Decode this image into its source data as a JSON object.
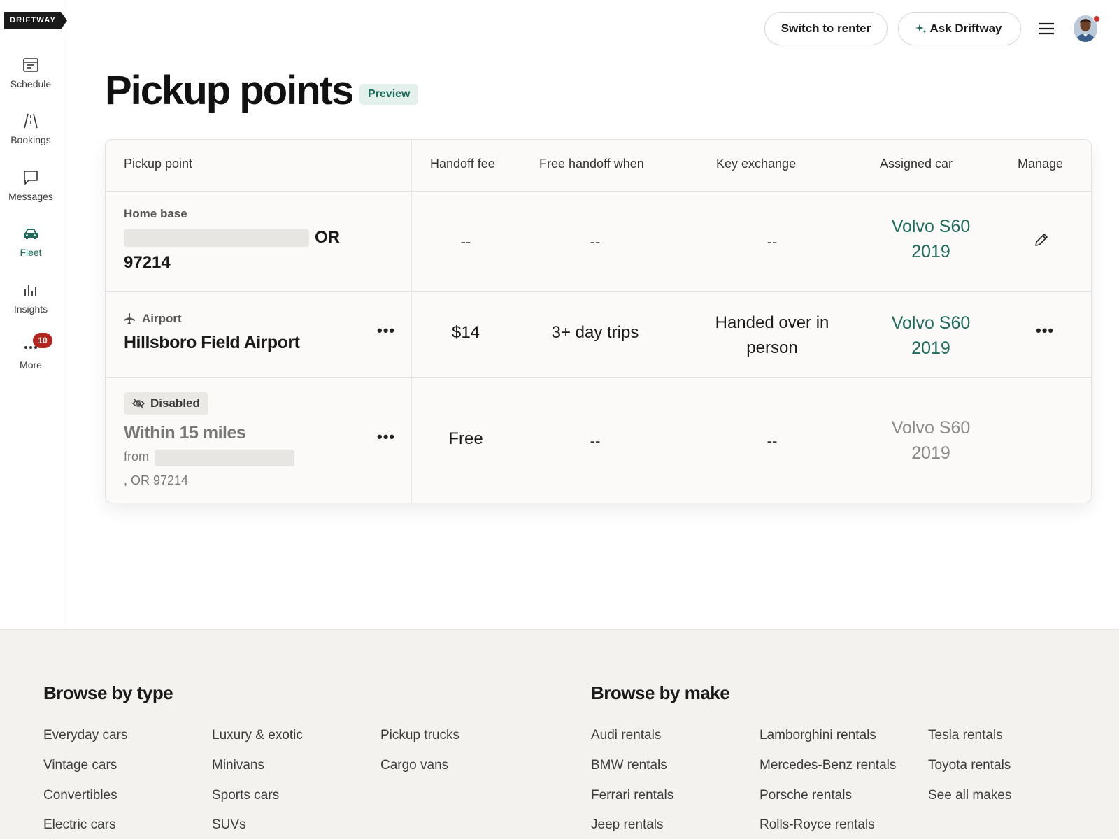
{
  "brand": {
    "logo_text": "DRIFTWAY"
  },
  "sidebar": {
    "items": [
      {
        "label": "Schedule"
      },
      {
        "label": "Bookings"
      },
      {
        "label": "Messages"
      },
      {
        "label": "Fleet"
      },
      {
        "label": "Insights"
      },
      {
        "label": "More",
        "badge": "10"
      }
    ],
    "active": "Fleet"
  },
  "topbar": {
    "switch_label": "Switch to renter",
    "ask_label": "Ask Driftway"
  },
  "page": {
    "title": "Pickup points",
    "badge": "Preview"
  },
  "table": {
    "headers": [
      "Pickup point",
      "Handoff fee",
      "Free handoff when",
      "Key exchange",
      "Assigned car",
      "Manage"
    ],
    "rows": [
      {
        "type_label": "Home base",
        "address_suffix": "OR",
        "zip": "97214",
        "fee": "--",
        "free_when": "--",
        "key_exchange": "--",
        "car_line1": "Volvo S60",
        "car_line2": "2019"
      },
      {
        "type_label": "Airport",
        "name": "Hillsboro Field Airport",
        "fee": "$14",
        "free_when": "3+ day trips",
        "key_exchange_line1": "Handed over in",
        "key_exchange_line2": "person",
        "car_line1": "Volvo S60",
        "car_line2": "2019"
      },
      {
        "status": "Disabled",
        "name": "Within 15 miles",
        "from_label": "from",
        "address_tail": ", OR 97214",
        "fee": "Free",
        "free_when": "--",
        "key_exchange": "--",
        "car_line1": "Volvo S60",
        "car_line2": "2019"
      }
    ]
  },
  "footer": {
    "type_heading": "Browse by type",
    "make_heading": "Browse by make",
    "types_col1": [
      "Everyday cars",
      "Vintage cars",
      "Convertibles",
      "Electric cars"
    ],
    "types_col2": [
      "Luxury & exotic",
      "Minivans",
      "Sports cars",
      "SUVs"
    ],
    "types_col3": [
      "Pickup trucks",
      "Cargo vans"
    ],
    "makes_col1": [
      "Audi rentals",
      "BMW rentals",
      "Ferrari rentals",
      "Jeep rentals"
    ],
    "makes_col2": [
      "Lamborghini rentals",
      "Mercedes-Benz rentals",
      "Porsche rentals",
      "Rolls-Royce rentals"
    ],
    "makes_col3": [
      "Tesla rentals",
      "Toyota rentals",
      "See all makes"
    ]
  },
  "colors": {
    "accent": "#1d6b5b",
    "badge_red": "#b3261e",
    "footer_bg": "#f3f2ef"
  }
}
